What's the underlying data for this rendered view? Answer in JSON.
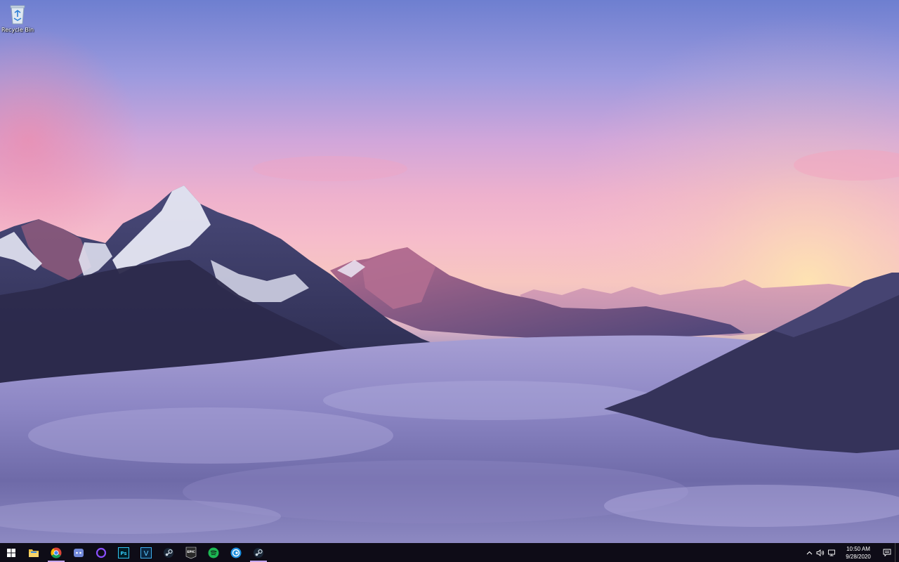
{
  "desktop": {
    "icons": [
      {
        "label": "Recycle Bin",
        "icon": "recycle-bin-icon"
      }
    ]
  },
  "taskbar": {
    "start_icon": "windows-logo-icon",
    "apps": [
      {
        "name": "File Explorer",
        "icon": "folder-icon",
        "running": false
      },
      {
        "name": "Google Chrome",
        "icon": "chrome-icon",
        "running": true
      },
      {
        "name": "Discord",
        "icon": "discord-icon",
        "running": false
      },
      {
        "name": "Cortana",
        "icon": "cortana-ring-icon",
        "running": false
      },
      {
        "name": "Adobe Photoshop",
        "icon": "photoshop-icon",
        "text": "Ps",
        "running": false
      },
      {
        "name": "Vegas",
        "icon": "vegas-icon",
        "text": "V",
        "running": false
      },
      {
        "name": "Steam",
        "icon": "steam-icon",
        "running": false
      },
      {
        "name": "Epic Games Launcher",
        "icon": "epic-games-icon",
        "text": "EPIC",
        "running": false
      },
      {
        "name": "Spotify",
        "icon": "spotify-icon",
        "running": false
      },
      {
        "name": "Uplay",
        "icon": "uplay-icon",
        "running": false
      },
      {
        "name": "Steam",
        "icon": "steam-icon",
        "running": true
      }
    ],
    "tray": {
      "icons": [
        "chevron-up-icon",
        "volume-icon",
        "network-icon"
      ],
      "time": "10:50 AM",
      "date": "9/28/2020",
      "notification_icon": "action-center-icon"
    },
    "colors": {
      "taskbar_bg": "#0e0c17",
      "running_indicator": "#c7a7f0"
    }
  }
}
